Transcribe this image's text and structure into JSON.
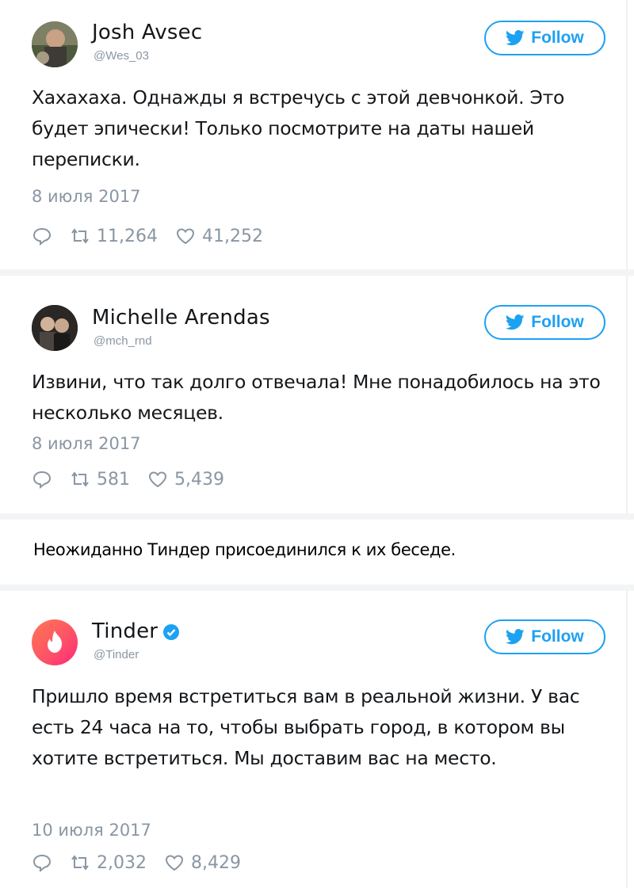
{
  "tweets": [
    {
      "name": "Josh Avsec",
      "handle": "@Wes_03",
      "follow_label": "Follow",
      "text": "Хахахаха. Однажды я встречусь с этой девчонкой. Это будет эпически! Только посмотрите на даты нашей переписки.",
      "date": "8 июля 2017",
      "retweets": "11,264",
      "likes": "41,252",
      "avatar_icon": "person-photo-avatar"
    },
    {
      "name": "Michelle Arendas",
      "handle": "@mch_rnd",
      "follow_label": "Follow",
      "text": "Извини, что так долго отвечала! Мне понадобилось на это несколько месяцев.",
      "date": "8 июля 2017",
      "retweets": "581",
      "likes": "5,439",
      "avatar_icon": "group-photo-avatar"
    },
    {
      "name": "Tinder",
      "handle": "@Tinder",
      "follow_label": "Follow",
      "verified": true,
      "text": "Пришло время встретиться вам в реальной жизни. У вас есть 24 часа на то, чтобы выбрать город, в котором вы хотите встретиться. Мы доставим вас на место.",
      "date": "10 июля 2017",
      "retweets": "2,032",
      "likes": "8,429",
      "avatar_icon": "tinder-flame-logo"
    }
  ],
  "caption": "Неожиданно Тиндер присоединился к их беседе.",
  "colors": {
    "accent": "#1da1f2",
    "muted": "#8a96a3",
    "text": "#14171a",
    "tinder_gradient_start": "#fd5068",
    "tinder_gradient_end": "#ff7854"
  }
}
